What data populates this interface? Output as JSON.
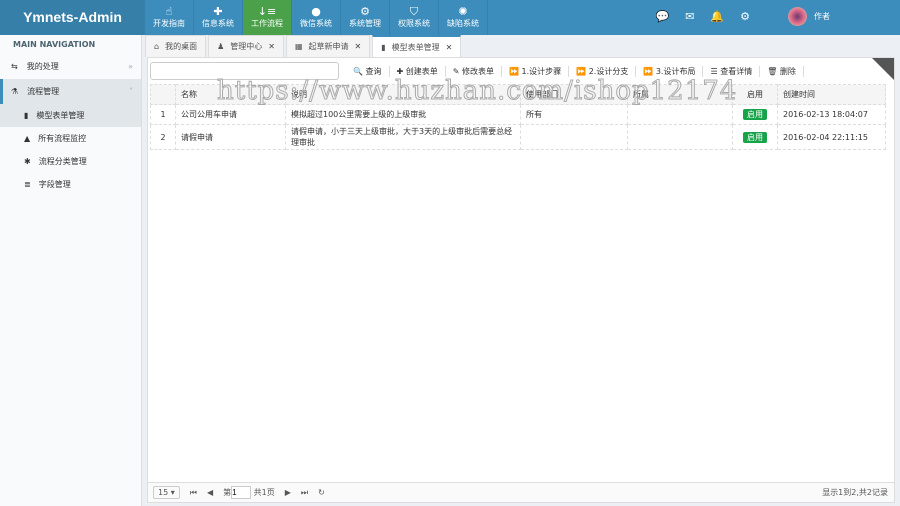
{
  "app_title": "Ymnets-Admin",
  "top_nav": [
    {
      "label": "开发指南",
      "icon": "hand-pointer-icon"
    },
    {
      "label": "信息系统",
      "icon": "puzzle-icon"
    },
    {
      "label": "工作流程",
      "icon": "sort-icon",
      "active": true
    },
    {
      "label": "微信系统",
      "icon": "wechat-icon"
    },
    {
      "label": "系统管理",
      "icon": "cogs-icon"
    },
    {
      "label": "权限系统",
      "icon": "shield-icon"
    },
    {
      "label": "缺陷系统",
      "icon": "bug-icon"
    }
  ],
  "user": {
    "name": "作者"
  },
  "sidebar": {
    "header": "MAIN NAVIGATION",
    "groups": [
      {
        "label": "我的处理"
      },
      {
        "label": "流程管理"
      }
    ],
    "items": [
      {
        "label": "模型表单管理"
      },
      {
        "label": "所有流程监控"
      },
      {
        "label": "流程分类管理"
      },
      {
        "label": "字段管理"
      }
    ]
  },
  "tabs": [
    {
      "label": "我的桌面"
    },
    {
      "label": "管理中心"
    },
    {
      "label": "起草新申请"
    },
    {
      "label": "模型表单管理"
    }
  ],
  "toolbar": {
    "search_value": "",
    "query": "查询",
    "create": "创建表单",
    "edit": "修改表单",
    "step1": "1.设计步骤",
    "step2": "2.设计分支",
    "step3": "3.设计布局",
    "details": "查看详情",
    "delete": "删除"
  },
  "table": {
    "headers": [
      "",
      "名称",
      "说明",
      "使用部门",
      "所属",
      "启用",
      "创建时间"
    ],
    "rows": [
      [
        "1",
        "公司公用车申请",
        "模拟超过100公里需要上级的上级审批",
        "所有",
        "",
        "启用",
        "2016-02-13 18:04:07"
      ],
      [
        "2",
        "请假申请",
        "请假申请，小于三天上级审批，大于3天的上级审批后需要总经理审批",
        "",
        "",
        "启用",
        "2016-02-04 22:11:15"
      ]
    ]
  },
  "pager": {
    "page_size": "15",
    "page_prefix": "第",
    "page": "1",
    "page_total": "共1页",
    "info": "显示1到2,共2记录"
  },
  "watermark": "https://www.huzhan.com/ishop12174",
  "colors": {
    "header": "#3c8dbc",
    "active_nav": "#4aa14a",
    "badge": "#16a34a"
  }
}
